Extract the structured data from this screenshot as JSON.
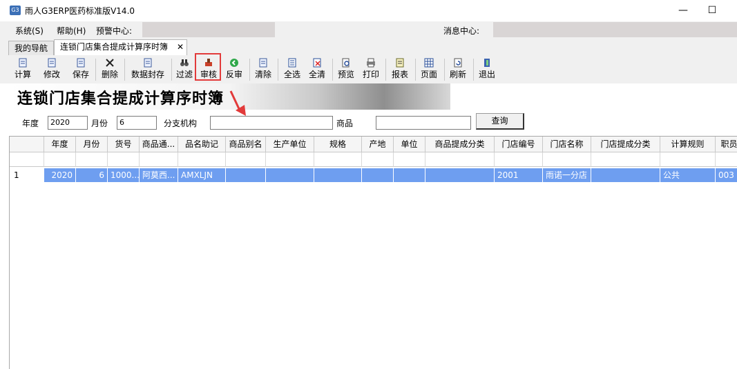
{
  "window": {
    "title": "雨人G3ERP医药标准版V14.0",
    "icon": "app-logo-icon",
    "minimize": "—",
    "maximize": "☐"
  },
  "menu": {
    "system": "系统(S)",
    "help": "帮助(H)",
    "alert_center": "预警中心:",
    "message_center": "消息中心:"
  },
  "tabs": [
    {
      "label": "我的导航"
    },
    {
      "label": "连锁门店集合提成计算序时簿",
      "close": "✕"
    }
  ],
  "toolbar": [
    {
      "label": "计算",
      "icon": "doc-icon"
    },
    {
      "label": "修改",
      "icon": "doc-icon"
    },
    {
      "label": "保存",
      "icon": "doc-icon"
    },
    {
      "label": "删除",
      "icon": "delete-x-icon"
    },
    {
      "label": "数据封存",
      "icon": "doc-icon"
    },
    {
      "label": "过滤",
      "icon": "binoculars-icon"
    },
    {
      "label": "审核",
      "icon": "stamp-icon"
    },
    {
      "label": "反审",
      "icon": "back-arrow-icon"
    },
    {
      "label": "清除",
      "icon": "doc-icon"
    },
    {
      "label": "全选",
      "icon": "select-all-icon"
    },
    {
      "label": "全清",
      "icon": "clear-all-icon"
    },
    {
      "label": "预览",
      "icon": "preview-icon"
    },
    {
      "label": "打印",
      "icon": "printer-icon"
    },
    {
      "label": "报表",
      "icon": "report-icon"
    },
    {
      "label": "页面",
      "icon": "grid-icon"
    },
    {
      "label": "刷新",
      "icon": "refresh-icon"
    },
    {
      "label": "退出",
      "icon": "exit-door-icon"
    }
  ],
  "banner": {
    "title": "连锁门店集合提成计算序时簿"
  },
  "filters": {
    "year_label": "年度",
    "year_value": "2020",
    "month_label": "月份",
    "month_value": "6",
    "branch_label": "分支机构",
    "branch_value": "",
    "product_label": "商品",
    "product_value": "",
    "query_button": "查询"
  },
  "grid": {
    "columns": [
      "年度",
      "月份",
      "货号",
      "商品通...",
      "品名助记",
      "商品别名",
      "生产单位",
      "规格",
      "产地",
      "单位",
      "商品提成分类",
      "门店编号",
      "门店名称",
      "门店提成分类",
      "计算规则",
      "职员"
    ],
    "rows": [
      {
        "row_no": "1",
        "cells": [
          "2020",
          "6",
          "1000...",
          "阿莫西...",
          "AMXLJN",
          "",
          "",
          "",
          "",
          "",
          "",
          "2001",
          "雨诺一分店",
          "",
          "公共",
          "003"
        ]
      }
    ]
  },
  "colors": {
    "selected_row": "#6e9ef0",
    "highlight": "#e23a3a",
    "arrow": "#e23a3a"
  }
}
